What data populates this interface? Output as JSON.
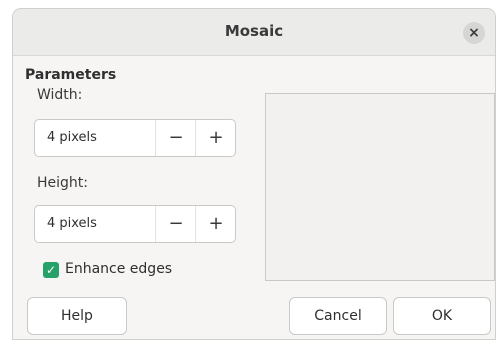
{
  "dialog": {
    "title": "Mosaic",
    "close_icon": "close-icon",
    "close_glyph": "×"
  },
  "parameters": {
    "section_label": "Parameters",
    "width": {
      "label": "Width:",
      "value": "4 pixels",
      "decrement": "−",
      "increment": "+"
    },
    "height": {
      "label": "Height:",
      "value": "4 pixels",
      "decrement": "−",
      "increment": "+"
    },
    "enhance_edges": {
      "label": "Enhance edges",
      "checked": true,
      "check_glyph": "✓"
    }
  },
  "buttons": {
    "help": "Help",
    "cancel": "Cancel",
    "ok": "OK"
  },
  "colors": {
    "accent_checkbox": "#26a269",
    "titlebar": "#ebebea",
    "dialog_bg": "#f6f5f4"
  }
}
